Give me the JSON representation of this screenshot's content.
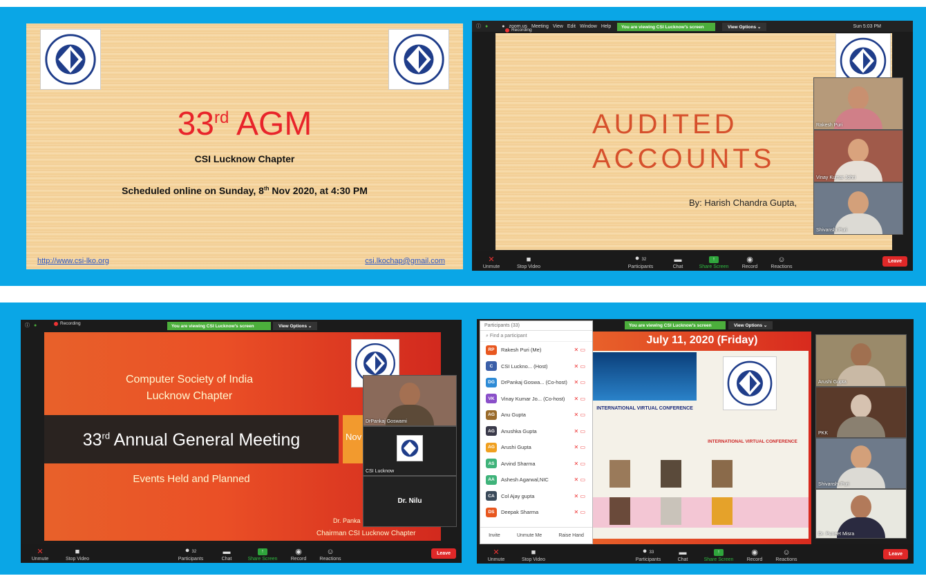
{
  "panel1": {
    "title_main": "33",
    "title_sup": "rd",
    "title_end": " AGM",
    "subtitle": "CSI Lucknow Chapter",
    "schedule_pre": "Scheduled online on Sunday, 8",
    "schedule_sup": "th",
    "schedule_post": " Nov 2020, at 4:30 PM",
    "link_left": "http://www.csi-lko.org",
    "link_right": "csi.lkochap@gmail.com",
    "logo_text": "COMPUTER SOCIETY OF INDIA",
    "logo_estd": "ESTD. 1965"
  },
  "zoom_common": {
    "viewing_banner": "You are viewing CSI Lucknow's screen",
    "view_options": "View Options ⌄",
    "recording": "Recording",
    "toolbar": {
      "unmute": "Unmute",
      "stop_video": "Stop Video",
      "participants": "Participants",
      "chat": "Chat",
      "share_screen": "Share Screen",
      "record": "Record",
      "reactions": "Reactions",
      "leave": "Leave"
    }
  },
  "panel2": {
    "mac_menu": [
      "zoom.us",
      "Meeting",
      "View",
      "Edit",
      "Window",
      "Help"
    ],
    "status_right": "Sun 5:03 PM",
    "participants_count": "32",
    "slide_line1": "AUDITED",
    "slide_line2": "ACCOUNTS",
    "slide_by": "By: Harish Chandra Gupta,",
    "thumbs": [
      "Rakesh Puri",
      "Vinay Kumar Johri",
      "Shivanshi Puri"
    ]
  },
  "panel3": {
    "participants_count": "32",
    "line1": "Computer Society of India",
    "line2": "Lucknow Chapter",
    "main_pre": "33",
    "main_sup": "rd",
    "main_post": " Annual General Meeting",
    "events": "Events Held and Planned",
    "side_tab": "Nov",
    "presenter": "Dr. Panka",
    "chairman": "Chairman CSI Lucknow Chapter",
    "thumbs": [
      "DrPankaj Goswami",
      "CSI Lucknow",
      "Dr. Nilu"
    ]
  },
  "panel4": {
    "participants_title": "Participants (33)",
    "search_placeholder": "Find a participant",
    "participants": [
      {
        "initials": "RP",
        "name": "Rakesh Puri (Me)",
        "color": "#e8571f"
      },
      {
        "initials": "C",
        "name": "CSI Luckno... (Host)",
        "color": "#3b5fa8"
      },
      {
        "initials": "DG",
        "name": "DrPankaj Goswa... (Co-host)",
        "color": "#2e8bd6"
      },
      {
        "initials": "VK",
        "name": "Vinay Kumar Jo... (Co-host)",
        "color": "#8a4fc9"
      },
      {
        "initials": "AG",
        "name": "Anu Gupta",
        "color": "#9a6b2b"
      },
      {
        "initials": "AG",
        "name": "Anushka Gupta",
        "color": "#3a3a4a"
      },
      {
        "initials": "AG",
        "name": "Arushi Gupta",
        "color": "#f0a020"
      },
      {
        "initials": "AS",
        "name": "Arvind Sharma",
        "color": "#3fb37a"
      },
      {
        "initials": "AA",
        "name": "Ashesh Agarwal,NIC",
        "color": "#3fb37a"
      },
      {
        "initials": "CA",
        "name": "Col Ajay gupta",
        "color": "#3a4a5a"
      },
      {
        "initials": "DS",
        "name": "Deepak Sharma",
        "color": "#e8571f"
      }
    ],
    "invite": "Invite",
    "unmute_me": "Unmute Me",
    "raise_hand": "Raise Hand",
    "participants_count": "33",
    "slide_date": "July 11, 2020 (Friday)",
    "conf_title": "INTERNATIONAL VIRTUAL CONFERENCE",
    "conf_right": "INTERNATIONAL VIRTUAL CONFERENCE",
    "thumbs": [
      "Arushi Gupta",
      "PKK",
      "Shivanshi Puri",
      "Dr. Puneet Misra"
    ]
  },
  "colors": {
    "band": "#0aa6e6",
    "agm_red": "#e8242a",
    "audited": "#d6502c",
    "zoom_green": "#4caf3c"
  }
}
